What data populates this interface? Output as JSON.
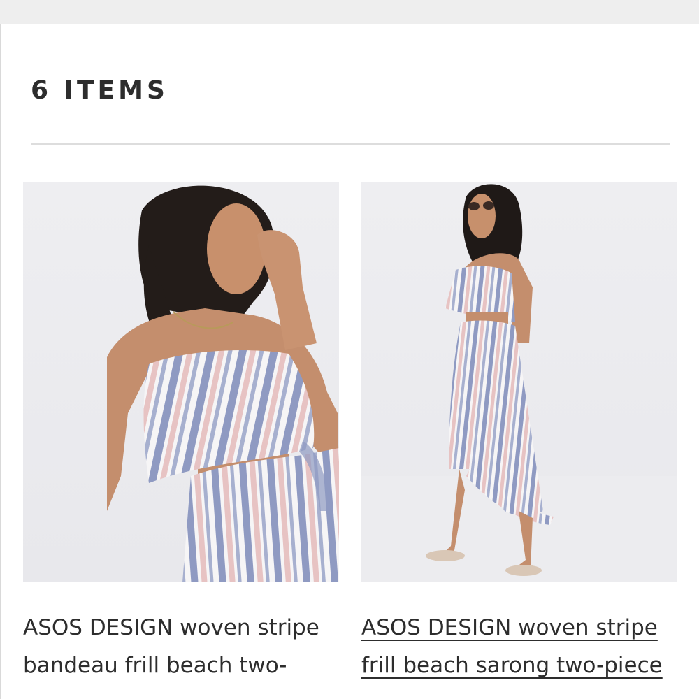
{
  "results": {
    "count_label": "6 ITEMS"
  },
  "products": [
    {
      "title_line1": "ASOS DESIGN woven stripe",
      "title_line2": "bandeau frill beach two-",
      "image": "model-close-up-striped-bandeau-top"
    },
    {
      "title_line1": "ASOS DESIGN woven stripe",
      "title_line2": "frill beach sarong two-piece",
      "image": "model-full-length-striped-sarong-set"
    }
  ],
  "colors": {
    "text": "#2d2d2d",
    "divider": "#dddddd",
    "top_bar": "#eeeeee",
    "stripe_blue": "#8f9ac2",
    "stripe_pink": "#e7c3c3",
    "stripe_white": "#f6f5f6"
  }
}
